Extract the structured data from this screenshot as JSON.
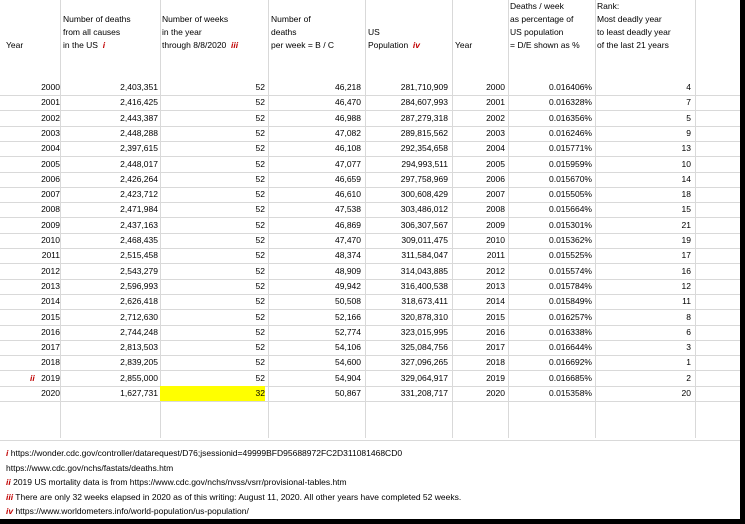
{
  "headers": {
    "year": [
      "Year"
    ],
    "deaths": [
      "Number of deaths",
      "from all causes",
      "in the US"
    ],
    "deaths_marker": "i",
    "weeks": [
      "Number of weeks",
      "in the year",
      "through 8/8/2020"
    ],
    "weeks_marker": "iii",
    "perweek": [
      "Number of",
      "deaths",
      "per week = B / C"
    ],
    "pop": [
      "US",
      "Population"
    ],
    "pop_marker": "iv",
    "year2": [
      "Year"
    ],
    "pct": [
      "Deaths / week",
      "as percentage of",
      "US population",
      "= D/E shown as %"
    ],
    "rank": [
      "Rank:",
      "Most deadly year",
      "to least deadly year",
      "of the last 21 years"
    ]
  },
  "rows": [
    {
      "year": "2000",
      "deaths": "2,403,351",
      "weeks": "52",
      "perweek": "46,218",
      "pop": "281,710,909",
      "year2": "2000",
      "pct": "0.016406%",
      "rank": "4",
      "marker": ""
    },
    {
      "year": "2001",
      "deaths": "2,416,425",
      "weeks": "52",
      "perweek": "46,470",
      "pop": "284,607,993",
      "year2": "2001",
      "pct": "0.016328%",
      "rank": "7",
      "marker": ""
    },
    {
      "year": "2002",
      "deaths": "2,443,387",
      "weeks": "52",
      "perweek": "46,988",
      "pop": "287,279,318",
      "year2": "2002",
      "pct": "0.016356%",
      "rank": "5",
      "marker": ""
    },
    {
      "year": "2003",
      "deaths": "2,448,288",
      "weeks": "52",
      "perweek": "47,082",
      "pop": "289,815,562",
      "year2": "2003",
      "pct": "0.016246%",
      "rank": "9",
      "marker": ""
    },
    {
      "year": "2004",
      "deaths": "2,397,615",
      "weeks": "52",
      "perweek": "46,108",
      "pop": "292,354,658",
      "year2": "2004",
      "pct": "0.015771%",
      "rank": "13",
      "marker": ""
    },
    {
      "year": "2005",
      "deaths": "2,448,017",
      "weeks": "52",
      "perweek": "47,077",
      "pop": "294,993,511",
      "year2": "2005",
      "pct": "0.015959%",
      "rank": "10",
      "marker": ""
    },
    {
      "year": "2006",
      "deaths": "2,426,264",
      "weeks": "52",
      "perweek": "46,659",
      "pop": "297,758,969",
      "year2": "2006",
      "pct": "0.015670%",
      "rank": "14",
      "marker": ""
    },
    {
      "year": "2007",
      "deaths": "2,423,712",
      "weeks": "52",
      "perweek": "46,610",
      "pop": "300,608,429",
      "year2": "2007",
      "pct": "0.015505%",
      "rank": "18",
      "marker": ""
    },
    {
      "year": "2008",
      "deaths": "2,471,984",
      "weeks": "52",
      "perweek": "47,538",
      "pop": "303,486,012",
      "year2": "2008",
      "pct": "0.015664%",
      "rank": "15",
      "marker": ""
    },
    {
      "year": "2009",
      "deaths": "2,437,163",
      "weeks": "52",
      "perweek": "46,869",
      "pop": "306,307,567",
      "year2": "2009",
      "pct": "0.015301%",
      "rank": "21",
      "marker": ""
    },
    {
      "year": "2010",
      "deaths": "2,468,435",
      "weeks": "52",
      "perweek": "47,470",
      "pop": "309,011,475",
      "year2": "2010",
      "pct": "0.015362%",
      "rank": "19",
      "marker": ""
    },
    {
      "year": "2011",
      "deaths": "2,515,458",
      "weeks": "52",
      "perweek": "48,374",
      "pop": "311,584,047",
      "year2": "2011",
      "pct": "0.015525%",
      "rank": "17",
      "marker": ""
    },
    {
      "year": "2012",
      "deaths": "2,543,279",
      "weeks": "52",
      "perweek": "48,909",
      "pop": "314,043,885",
      "year2": "2012",
      "pct": "0.015574%",
      "rank": "16",
      "marker": ""
    },
    {
      "year": "2013",
      "deaths": "2,596,993",
      "weeks": "52",
      "perweek": "49,942",
      "pop": "316,400,538",
      "year2": "2013",
      "pct": "0.015784%",
      "rank": "12",
      "marker": ""
    },
    {
      "year": "2014",
      "deaths": "2,626,418",
      "weeks": "52",
      "perweek": "50,508",
      "pop": "318,673,411",
      "year2": "2014",
      "pct": "0.015849%",
      "rank": "11",
      "marker": ""
    },
    {
      "year": "2015",
      "deaths": "2,712,630",
      "weeks": "52",
      "perweek": "52,166",
      "pop": "320,878,310",
      "year2": "2015",
      "pct": "0.016257%",
      "rank": "8",
      "marker": ""
    },
    {
      "year": "2016",
      "deaths": "2,744,248",
      "weeks": "52",
      "perweek": "52,774",
      "pop": "323,015,995",
      "year2": "2016",
      "pct": "0.016338%",
      "rank": "6",
      "marker": ""
    },
    {
      "year": "2017",
      "deaths": "2,813,503",
      "weeks": "52",
      "perweek": "54,106",
      "pop": "325,084,756",
      "year2": "2017",
      "pct": "0.016644%",
      "rank": "3",
      "marker": ""
    },
    {
      "year": "2018",
      "deaths": "2,839,205",
      "weeks": "52",
      "perweek": "54,600",
      "pop": "327,096,265",
      "year2": "2018",
      "pct": "0.016692%",
      "rank": "1",
      "marker": ""
    },
    {
      "year": "2019",
      "deaths": "2,855,000",
      "weeks": "52",
      "perweek": "54,904",
      "pop": "329,064,917",
      "year2": "2019",
      "pct": "0.016685%",
      "rank": "2",
      "marker": "ii"
    },
    {
      "year": "2020",
      "deaths": "1,627,731",
      "weeks": "32",
      "perweek": "50,867",
      "pop": "331,208,717",
      "year2": "2020",
      "pct": "0.015358%",
      "rank": "20",
      "marker": "",
      "highlight_weeks": true
    }
  ],
  "notes": [
    {
      "marker": "i",
      "text": " https://wonder.cdc.gov/controller/datarequest/D76;jsessionid=49999BFD95688972FC2D311081468CD0"
    },
    {
      "marker": "",
      "text": "https://www.cdc.gov/nchs/fastats/deaths.htm"
    },
    {
      "marker": "ii",
      "text": " 2019 US mortality data is from https://www.cdc.gov/nchs/nvss/vsrr/provisional-tables.htm"
    },
    {
      "marker": "iii",
      "text": " There are only 32 weeks elapsed in 2020 as of this writing: August 11, 2020.  All other years have completed 52 weeks."
    },
    {
      "marker": "iv",
      "text": " https://www.worldometers.info/world-population/us-population/"
    }
  ],
  "colors": {
    "highlight": "#ffff00",
    "marker": "#c00000",
    "grid": "#d9d9d9",
    "frame": "#000000"
  }
}
